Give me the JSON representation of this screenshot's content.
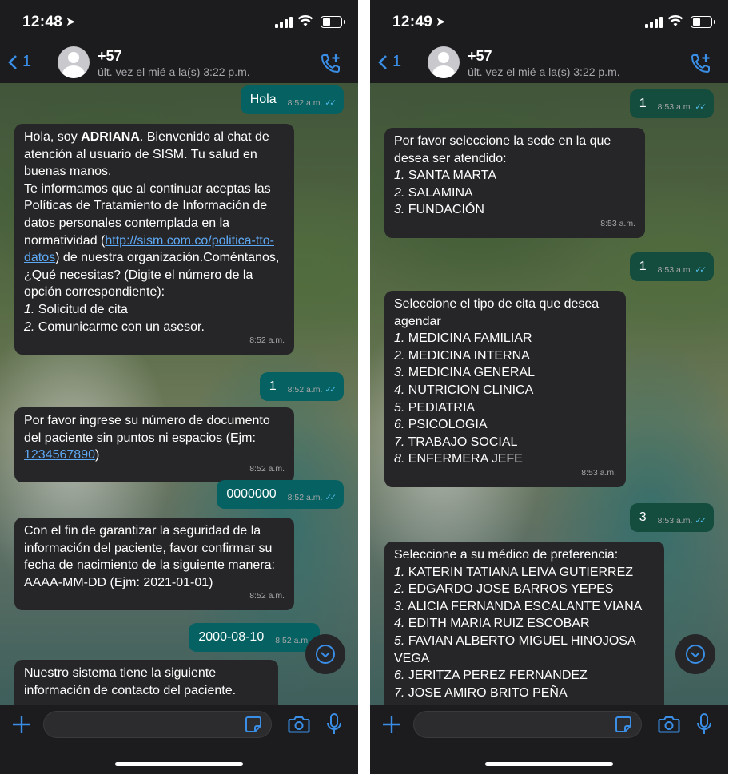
{
  "screens": [
    {
      "time": "12:48",
      "back_count": "1",
      "contact_name": "+57",
      "contact_status": "últ. vez el mié a la(s) 3:22 p.m.",
      "messages": [
        {
          "text": "Hola",
          "time": "8:52 a.m."
        },
        {
          "text_before": "Hola, soy ",
          "bold": "ADRIANA",
          "text_mid": ". Bienvenido al chat de atención al usuario de SISM. Tu salud en buenas manos.\nTe informamos que al continuar aceptas las Políticas de Tratamiento de Información de datos personales contemplada en la normatividad (",
          "link": "http://sism.com.co/politica-tto-datos",
          "text_after": ") de nuestra organización.Coméntanos, ¿Qué necesitas? (Digite el número de la opción correspondiente):",
          "options": [
            {
              "n": "1.",
              "label": "Solicitud de cita"
            },
            {
              "n": "2.",
              "label": "Comunicarme con un asesor."
            }
          ],
          "time": "8:52 a.m."
        },
        {
          "text": "1",
          "time": "8:52 a.m."
        },
        {
          "text": "Por favor ingrese su número de documento del paciente sin puntos ni espacios (Ejm:",
          "link": "1234567890",
          "text_after": ")",
          "time": "8:52 a.m."
        },
        {
          "text": "0000000",
          "time": "8:52 a.m."
        },
        {
          "text": "Con el fin de garantizar la seguridad de la información del paciente, favor confirmar su fecha de nacimiento de la siguiente manera: AAAA-MM-DD (Ejm: 2021-01-01)",
          "time": "8:52 a.m."
        },
        {
          "text": "2000-08-10",
          "time": "8:52 a.m."
        },
        {
          "text": "Nuestro sistema tiene la siguiente información de contacto del paciente."
        }
      ]
    },
    {
      "time": "12:49",
      "back_count": "1",
      "contact_name": "+57",
      "contact_status": "últ. vez el mié a la(s) 3:22 p.m.",
      "messages": [
        {
          "text": "1",
          "time": "8:53 a.m."
        },
        {
          "text": "Por favor seleccione la sede en la que desea ser atendido:",
          "options": [
            {
              "n": "1.",
              "label": "SANTA MARTA"
            },
            {
              "n": "2.",
              "label": "SALAMINA"
            },
            {
              "n": "3.",
              "label": "FUNDACIÓN"
            }
          ],
          "time": "8:53 a.m."
        },
        {
          "text": "1",
          "time": "8:53 a.m."
        },
        {
          "text": "Seleccione el tipo de cita que desea agendar",
          "options": [
            {
              "n": "1.",
              "label": "MEDICINA FAMILIAR"
            },
            {
              "n": "2.",
              "label": "MEDICINA INTERNA"
            },
            {
              "n": "3.",
              "label": "MEDICINA GENERAL"
            },
            {
              "n": "4.",
              "label": "NUTRICION CLINICA"
            },
            {
              "n": "5.",
              "label": "PEDIATRIA"
            },
            {
              "n": "6.",
              "label": "PSICOLOGIA"
            },
            {
              "n": "7.",
              "label": "TRABAJO SOCIAL"
            },
            {
              "n": "8.",
              "label": "ENFERMERA JEFE"
            }
          ],
          "time": "8:53 a.m."
        },
        {
          "text": "3",
          "time": "8:53 a.m."
        },
        {
          "text": "Seleccione a su médico de preferencia:",
          "options": [
            {
              "n": "1.",
              "label": "KATERIN TATIANA LEIVA GUTIERREZ"
            },
            {
              "n": "2.",
              "label": "EDGARDO JOSE BARROS YEPES"
            },
            {
              "n": "3.",
              "label": "ALICIA FERNANDA ESCALANTE VIANA"
            },
            {
              "n": "4.",
              "label": "EDITH MARIA RUIZ ESCOBAR"
            },
            {
              "n": "5.",
              "label": "FAVIAN ALBERTO MIGUEL HINOJOSA VEGA"
            },
            {
              "n": "6.",
              "label": "JERITZA PEREZ FERNANDEZ"
            },
            {
              "n": "7.",
              "label": "JOSE AMIRO BRITO PEÑA"
            }
          ]
        }
      ]
    }
  ],
  "colors": {
    "accent": "#3a8ee6",
    "incoming_bubble": "#262628",
    "outgoing_bubble": "#056162",
    "read_ticks": "#53bdeb",
    "link": "#5ea9f5"
  },
  "icons": [
    "location-arrow-icon",
    "signal-icon",
    "wifi-icon",
    "battery-icon",
    "back-chevron-icon",
    "avatar-placeholder-icon",
    "add-call-icon",
    "chevron-down-icon",
    "plus-icon",
    "sticker-icon",
    "camera-icon",
    "microphone-icon"
  ]
}
